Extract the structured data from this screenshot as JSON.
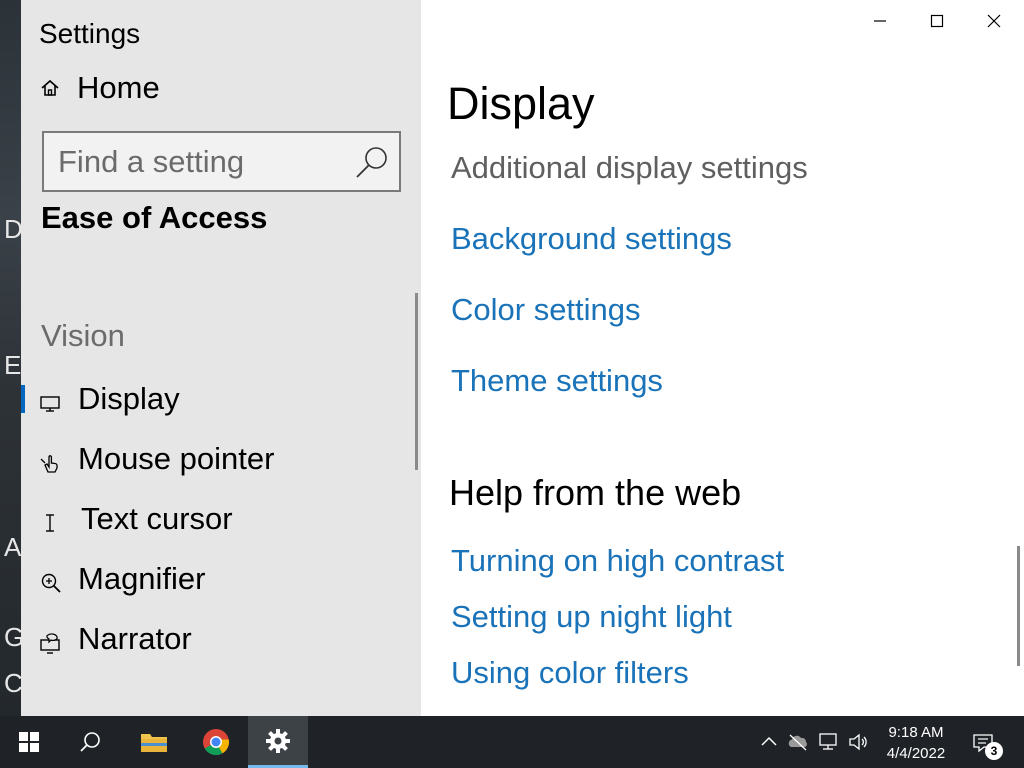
{
  "window": {
    "title": "Settings"
  },
  "sidebar": {
    "home_label": "Home",
    "search_placeholder": "Find a setting",
    "category": "Ease of Access",
    "group_label": "Vision",
    "items": [
      {
        "label": "Display",
        "icon": "monitor-icon",
        "selected": true
      },
      {
        "label": "Mouse pointer",
        "icon": "mouse-pointer-icon",
        "selected": false
      },
      {
        "label": "Text cursor",
        "icon": "text-cursor-icon",
        "selected": false
      },
      {
        "label": "Magnifier",
        "icon": "magnifier-icon",
        "selected": false
      },
      {
        "label": "Narrator",
        "icon": "narrator-icon",
        "selected": false
      }
    ]
  },
  "main": {
    "page_title": "Display",
    "section_heading": "Additional display settings",
    "links": [
      "Background settings",
      "Color settings",
      "Theme settings"
    ],
    "help_heading": "Help from the web",
    "help_links": [
      "Turning on high contrast",
      "Setting up night light",
      "Using color filters"
    ]
  },
  "taskbar": {
    "time": "9:18 AM",
    "date": "4/4/2022",
    "notification_count": "3",
    "pinned": [
      "start-icon",
      "search-icon",
      "file-explorer-icon",
      "chrome-icon",
      "settings-icon"
    ],
    "active": "settings-icon"
  },
  "colors": {
    "link": "#1a73b8",
    "accent": "#0067c0",
    "sidebar_bg": "#e6e6e6",
    "taskbar_bg": "#1f2327"
  }
}
